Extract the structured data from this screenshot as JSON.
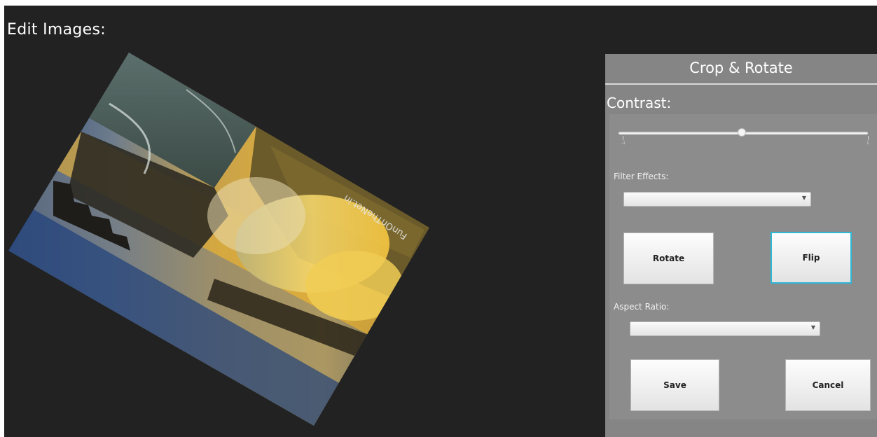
{
  "window": {
    "title": "Edit Images:"
  },
  "image": {
    "watermark": "FunOnTheNet.in",
    "rotation_deg": -33,
    "flipped": true
  },
  "panel": {
    "title": "Crop & Rotate",
    "contrast": {
      "label": "Contrast:",
      "value": 0,
      "min_label": "-1",
      "max_label": "1"
    },
    "filter_effects": {
      "label": "Filter Effects:",
      "value": ""
    },
    "rotate_label": "Rotate",
    "flip_label": "Flip",
    "aspect_ratio": {
      "label": "Aspect Ratio:",
      "value": ""
    },
    "save_label": "Save",
    "cancel_label": "Cancel"
  },
  "colors": {
    "background": "#222222",
    "panel": "#858585",
    "focus": "#2fb7d6"
  }
}
